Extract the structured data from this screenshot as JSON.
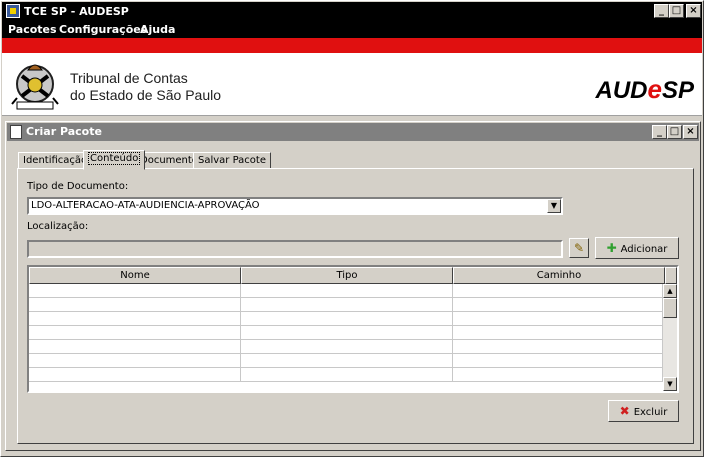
{
  "window": {
    "title": "TCE SP - AUDESP"
  },
  "menu": {
    "items": [
      "Pacotes",
      "Configurações",
      "Ajuda"
    ]
  },
  "banner": {
    "org_line1": "Tribunal de Contas",
    "org_line2": "do Estado de São Paulo",
    "brand_prefix": "AUD",
    "brand_e": "e",
    "brand_suffix": "SP"
  },
  "dialog": {
    "title": "Criar Pacote",
    "tabs": [
      "Identificação",
      "Conteúdo",
      "Documentos",
      "Salvar Pacote"
    ],
    "active_tab": "Conteúdo",
    "tipo_label": "Tipo de Documento:",
    "tipo_value": "LDO-ALTERACAO-ATA-AUDIENCIA-APROVAÇÃO",
    "localizacao_label": "Localização:",
    "localizacao_value": "",
    "add_button": "Adicionar",
    "delete_button": "Excluir",
    "table": {
      "columns": [
        "Nome",
        "Tipo",
        "Caminho"
      ],
      "rows": []
    }
  },
  "colors": {
    "title_bg": "#000000",
    "accent_red": "#e01010",
    "inactive_title": "#808080"
  },
  "icons": {
    "app": "app-icon",
    "doc": "document-icon",
    "browse": "wand-icon",
    "add": "plus-icon",
    "delete": "x-icon"
  }
}
